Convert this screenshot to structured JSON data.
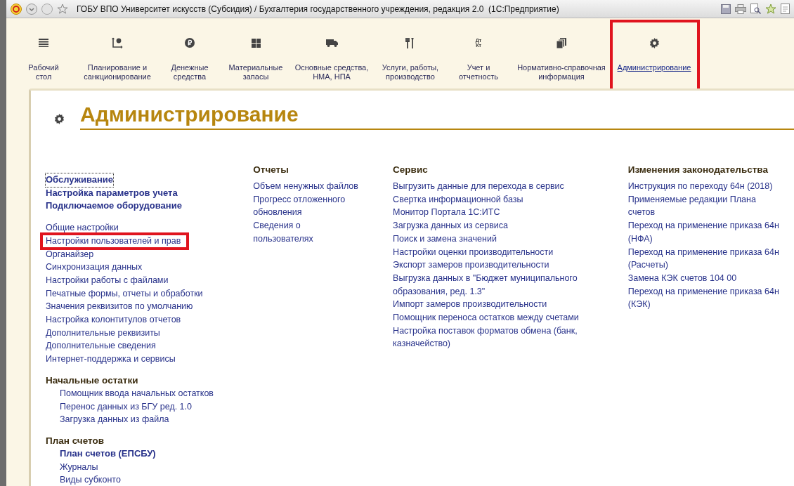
{
  "window": {
    "title": "ГОБУ ВПО Университет искусств (Субсидия) / Бухгалтерия государственного учреждения, редакция 2.0  (1С:Предприятие)"
  },
  "sections": [
    {
      "label": "Рабочий\nстол",
      "selected": false,
      "highlighted": false
    },
    {
      "label": "Планирование и\nсанкционирование",
      "selected": false,
      "highlighted": false
    },
    {
      "label": "Денежные\nсредства",
      "selected": false,
      "highlighted": false
    },
    {
      "label": "Материальные\nзапасы",
      "selected": false,
      "highlighted": false
    },
    {
      "label": "Основные средства,\nНМА, НПА",
      "selected": false,
      "highlighted": false
    },
    {
      "label": "Услуги, работы,\nпроизводство",
      "selected": false,
      "highlighted": false
    },
    {
      "label": "Учет и\nотчетность",
      "selected": false,
      "highlighted": false,
      "icon_text": "Дт\nКт"
    },
    {
      "label": "Нормативно-справочная\nинформация",
      "selected": false,
      "highlighted": false
    },
    {
      "label": "Администрирование",
      "selected": true,
      "highlighted": true
    }
  ],
  "page_title": "Администрирование",
  "columns": [
    {
      "groups": [
        {
          "items": [
            {
              "text": "Обслуживание",
              "bold": true,
              "focused": true,
              "highlighted": false
            },
            {
              "text": "Настройка параметров учета",
              "bold": true,
              "focused": false,
              "highlighted": false
            },
            {
              "text": "Подключаемое оборудование",
              "bold": true,
              "focused": false,
              "highlighted": false
            }
          ]
        },
        {
          "items": [
            {
              "text": "Общие настройки",
              "bold": false,
              "focused": false,
              "highlighted": false
            },
            {
              "text": "Настройки пользователей и прав",
              "bold": false,
              "focused": false,
              "highlighted": true
            },
            {
              "text": "Органайзер",
              "bold": false,
              "focused": false,
              "highlighted": false
            },
            {
              "text": "Синхронизация данных",
              "bold": false,
              "focused": false,
              "highlighted": false
            },
            {
              "text": "Настройки работы с файлами",
              "bold": false,
              "focused": false,
              "highlighted": false
            },
            {
              "text": "Печатные формы, отчеты и обработки",
              "bold": false,
              "focused": false,
              "highlighted": false
            },
            {
              "text": "Значения реквизитов по умолчанию",
              "bold": false,
              "focused": false,
              "highlighted": false
            },
            {
              "text": "Настройка колонтитулов отчетов",
              "bold": false,
              "focused": false,
              "highlighted": false
            },
            {
              "text": "Дополнительные реквизиты",
              "bold": false,
              "focused": false,
              "highlighted": false
            },
            {
              "text": "Дополнительные сведения",
              "bold": false,
              "focused": false,
              "highlighted": false
            },
            {
              "text": "Интернет-поддержка и сервисы",
              "bold": false,
              "focused": false,
              "highlighted": false
            }
          ]
        },
        {
          "heading": "Начальные остатки",
          "children": [
            {
              "text": "Помощник ввода начальных остатков",
              "bold": false,
              "focused": false,
              "highlighted": false
            },
            {
              "text": "Перенос данных из БГУ ред. 1.0",
              "bold": false,
              "focused": false,
              "highlighted": false
            },
            {
              "text": "Загрузка данных из файла",
              "bold": false,
              "focused": false,
              "highlighted": false
            }
          ]
        },
        {
          "heading": "План счетов",
          "children": [
            {
              "text": "План счетов (ЕПСБУ)",
              "bold": true,
              "focused": false,
              "highlighted": false
            },
            {
              "text": "Журналы",
              "bold": false,
              "focused": false,
              "highlighted": false
            },
            {
              "text": "Виды субконто",
              "bold": false,
              "focused": false,
              "highlighted": false
            }
          ]
        }
      ]
    },
    {
      "groups": [
        {
          "heading": "Отчеты",
          "items": [
            {
              "text": "Объем ненужных файлов",
              "bold": false,
              "focused": false,
              "highlighted": false
            },
            {
              "text": "Прогресс отложенного\nобновления",
              "bold": false,
              "focused": false,
              "highlighted": false
            },
            {
              "text": "Сведения о\nпользователях",
              "bold": false,
              "focused": false,
              "highlighted": false
            }
          ]
        }
      ]
    },
    {
      "groups": [
        {
          "heading": "Сервис",
          "items": [
            {
              "text": "Выгрузить данные для перехода в сервис",
              "bold": false,
              "focused": false,
              "highlighted": false
            },
            {
              "text": "Свертка информационной базы",
              "bold": false,
              "focused": false,
              "highlighted": false
            },
            {
              "text": "Монитор Портала 1С:ИТС",
              "bold": false,
              "focused": false,
              "highlighted": false
            },
            {
              "text": "Загрузка данных из сервиса",
              "bold": false,
              "focused": false,
              "highlighted": false
            },
            {
              "text": "Поиск и замена значений",
              "bold": false,
              "focused": false,
              "highlighted": false
            },
            {
              "text": "Настройки оценки производительности",
              "bold": false,
              "focused": false,
              "highlighted": false
            },
            {
              "text": "Экспорт замеров производительности",
              "bold": false,
              "focused": false,
              "highlighted": false
            },
            {
              "text": "Выгрузка данных в \"Бюджет муниципального\nобразования, ред. 1.3\"",
              "bold": false,
              "focused": false,
              "highlighted": false
            },
            {
              "text": "Импорт замеров производительности",
              "bold": false,
              "focused": false,
              "highlighted": false
            },
            {
              "text": "Помощник переноса остатков между счетами",
              "bold": false,
              "focused": false,
              "highlighted": false
            },
            {
              "text": "Настройка поставок форматов обмена (банк,\nказначейство)",
              "bold": false,
              "focused": false,
              "highlighted": false
            }
          ]
        }
      ]
    },
    {
      "groups": [
        {
          "heading": "Изменения законодательства",
          "items": [
            {
              "text": "Инструкция по переходу 64н (2018)",
              "bold": false,
              "focused": false,
              "highlighted": false
            },
            {
              "text": "Применяемые редакции Плана\nсчетов",
              "bold": false,
              "focused": false,
              "highlighted": false
            },
            {
              "text": "Переход на применение приказа 64н\n(НФА)",
              "bold": false,
              "focused": false,
              "highlighted": false
            },
            {
              "text": "Переход на применение приказа 64н\n(Расчеты)",
              "bold": false,
              "focused": false,
              "highlighted": false
            },
            {
              "text": "Замена КЭК счетов 104 00",
              "bold": false,
              "focused": false,
              "highlighted": false
            },
            {
              "text": "Переход на применение приказа 64н\n(КЭК)",
              "bold": false,
              "focused": false,
              "highlighted": false
            }
          ]
        }
      ]
    }
  ]
}
